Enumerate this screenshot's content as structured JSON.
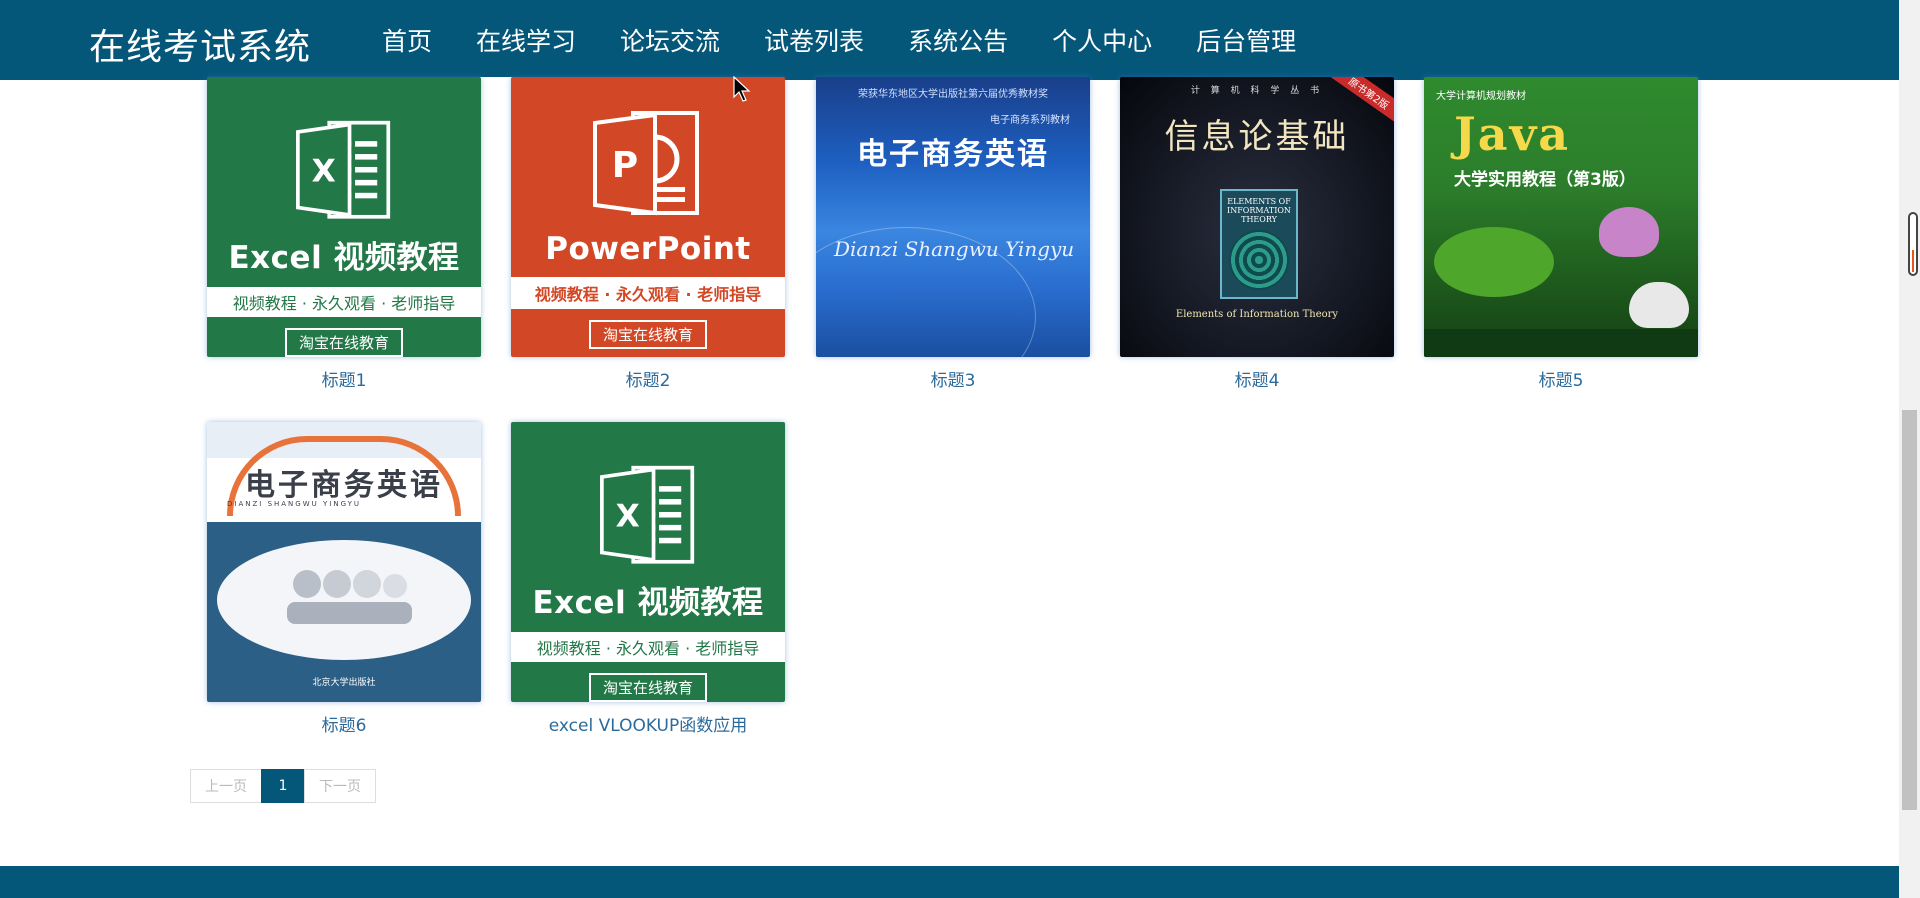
{
  "header": {
    "brand": "在线考试系统",
    "nav": [
      {
        "label": "首页",
        "active": false
      },
      {
        "label": "在线学习",
        "active": true
      },
      {
        "label": "论坛交流",
        "active": false
      },
      {
        "label": "试卷列表",
        "active": false
      },
      {
        "label": "系统公告",
        "active": false
      },
      {
        "label": "个人中心",
        "active": false
      },
      {
        "label": "后台管理",
        "active": false
      }
    ]
  },
  "courses": [
    {
      "title": "标题1",
      "cover": {
        "style": "excel",
        "headline": "Excel 视频教程",
        "band": "视频教程 · 永久观看 · 老师指导",
        "stamp": "淘宝在线教育"
      }
    },
    {
      "title": "标题2",
      "cover": {
        "style": "powerpoint",
        "headline": "PowerPoint",
        "band": "视频教程 · 永久观看 · 老师指导",
        "stamp": "淘宝在线教育"
      }
    },
    {
      "title": "标题3",
      "cover": {
        "style": "book",
        "top": "荣获华东地区大学出版社第六届优秀教材奖",
        "sub": "电子商务系列教材",
        "main": "电子商务英语",
        "pinyin": "Dianzi Shangwu Yingyu"
      }
    },
    {
      "title": "标题4",
      "cover": {
        "style": "book",
        "series": "计 算 机 科 学 丛 书",
        "main": "信息论基础",
        "tag": "原书第2版",
        "inner_title": "ELEMENTS OF INFORMATION THEORY",
        "footer": "Elements of Information Theory"
      }
    },
    {
      "title": "标题5",
      "cover": {
        "style": "book",
        "top": "大学计算机规划教材",
        "main": "Java",
        "sub": "大学实用教程（第3版）"
      }
    },
    {
      "title": "标题6",
      "cover": {
        "style": "book",
        "main": "电子商务英语",
        "pinyin": "DIANZI SHANGWU YINGYU",
        "publisher": "北京大学出版社"
      }
    },
    {
      "title": "excel VLOOKUP函数应用",
      "cover": {
        "style": "excel",
        "headline": "Excel 视频教程",
        "band": "视频教程 · 永久观看 · 老师指导",
        "stamp": "淘宝在线教育"
      }
    }
  ],
  "pagination": {
    "prev": "上一页",
    "current": "1",
    "next": "下一页"
  },
  "colors": {
    "primary": "#05577a",
    "link": "#2c6a9a",
    "excel": "#237848",
    "powerpoint": "#d24726"
  }
}
